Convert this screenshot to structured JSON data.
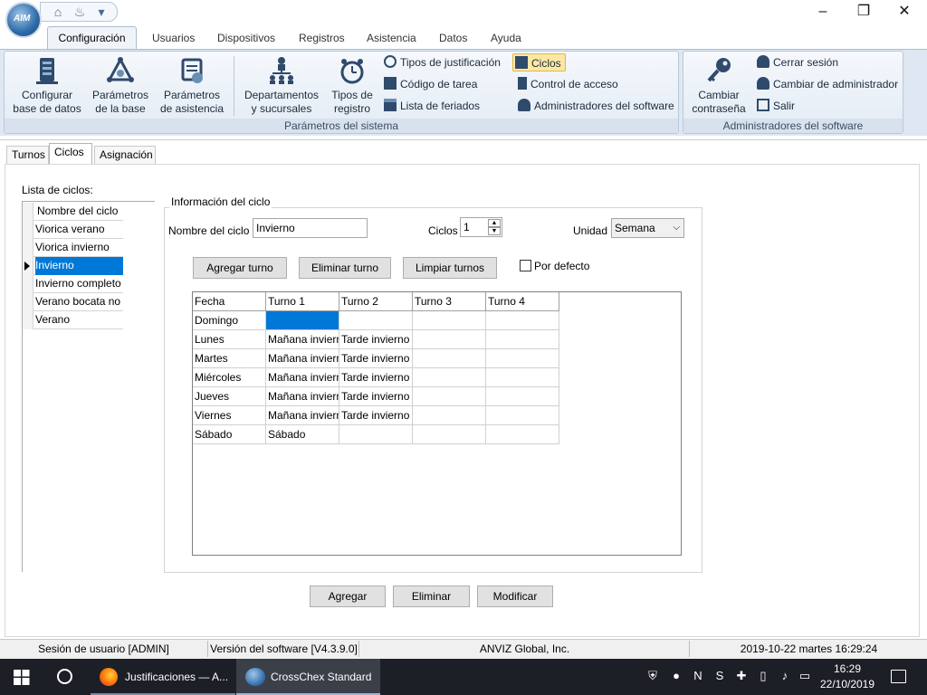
{
  "app": {
    "logo_text": "AIM",
    "window_controls": {
      "minimize": "–",
      "maximize": "❐",
      "close": "✕"
    }
  },
  "menu": {
    "tabs": [
      "Configuración",
      "Usuarios",
      "Dispositivos",
      "Registros",
      "Asistencia",
      "Datos",
      "Ayuda"
    ]
  },
  "ribbon": {
    "system_group": {
      "label": "Parámetros del sistema",
      "buttons": [
        {
          "line1": "Configurar",
          "line2": "base de datos",
          "icon": "database-icon"
        },
        {
          "line1": "Parámetros",
          "line2": "de la base",
          "icon": "network-gear-icon"
        },
        {
          "line1": "Parámetros",
          "line2": "de asistencia",
          "icon": "attendance-icon"
        },
        {
          "line1": "Departamentos",
          "line2": "y sucursales",
          "icon": "org-chart-icon"
        },
        {
          "line1": "Tipos de",
          "line2": "registro",
          "icon": "alarm-clock-icon"
        }
      ],
      "small1": [
        "Tipos de justificación",
        "Código de tarea",
        "Lista de feriados"
      ],
      "small2": [
        "Ciclos",
        "Control de acceso",
        "Administradores del software"
      ]
    },
    "admin_group": {
      "label": "Administradores del software",
      "big": {
        "line1": "Cambiar",
        "line2": "contraseña",
        "icon": "key-icon"
      },
      "small": [
        "Cerrar sesión",
        "Cambiar de administrador",
        "Salir"
      ]
    }
  },
  "content_tabs": [
    "Turnos",
    "Ciclos",
    "Asignación"
  ],
  "cycles": {
    "list_label": "Lista de ciclos:",
    "list_header": "Nombre del ciclo",
    "items": [
      "Viorica verano",
      "Viorica invierno",
      "Invierno",
      "Invierno completo",
      "Verano bocata no",
      "Verano"
    ],
    "selected_index": 2
  },
  "info": {
    "legend": "Información del ciclo",
    "name_label": "Nombre del ciclo",
    "name_value": "Invierno",
    "cycles_label": "Ciclos",
    "cycles_value": "1",
    "unit_label": "Unidad",
    "unit_value": "Semana",
    "buttons": {
      "add_shift": "Agregar turno",
      "remove_shift": "Eliminar turno",
      "clear_shifts": "Limpiar turnos"
    },
    "default_label": "Por defecto"
  },
  "grid": {
    "headers": [
      "Fecha",
      "Turno 1",
      "Turno 2",
      "Turno 3",
      "Turno 4"
    ],
    "rows": [
      [
        "Domingo",
        "",
        "",
        "",
        ""
      ],
      [
        "Lunes",
        "Mañana invierno",
        "Tarde invierno",
        "",
        ""
      ],
      [
        "Martes",
        "Mañana invierno",
        "Tarde invierno",
        "",
        ""
      ],
      [
        "Miércoles",
        "Mañana invierno",
        "Tarde invierno",
        "",
        ""
      ],
      [
        "Jueves",
        "Mañana invierno",
        "Tarde invierno",
        "",
        ""
      ],
      [
        "Viernes",
        "Mañana invierno",
        "Tarde invierno",
        "",
        ""
      ],
      [
        "Sábado",
        "Sábado",
        "",
        "",
        ""
      ]
    ]
  },
  "actions": {
    "add": "Agregar",
    "delete": "Eliminar",
    "modify": "Modificar"
  },
  "status": {
    "session": "Sesión de usuario  [ADMIN]",
    "version": "Versión del software  [V4.3.9.0]",
    "company": "ANVIZ Global, Inc.",
    "datetime": "2019-10-22 martes 16:29:24"
  },
  "taskbar": {
    "apps": [
      {
        "label": "Justificaciones — A...",
        "icon": "firefox-icon"
      },
      {
        "label": "CrossChex Standard",
        "icon": "crosschex-icon"
      }
    ],
    "time": "16:29",
    "date": "22/10/2019"
  },
  "colors": {
    "selection": "#0078d7",
    "ribbon_bg": "#dfe8f2",
    "ciclos_highlight": "#fde7a5",
    "taskbar_bg": "#1c1f26"
  }
}
